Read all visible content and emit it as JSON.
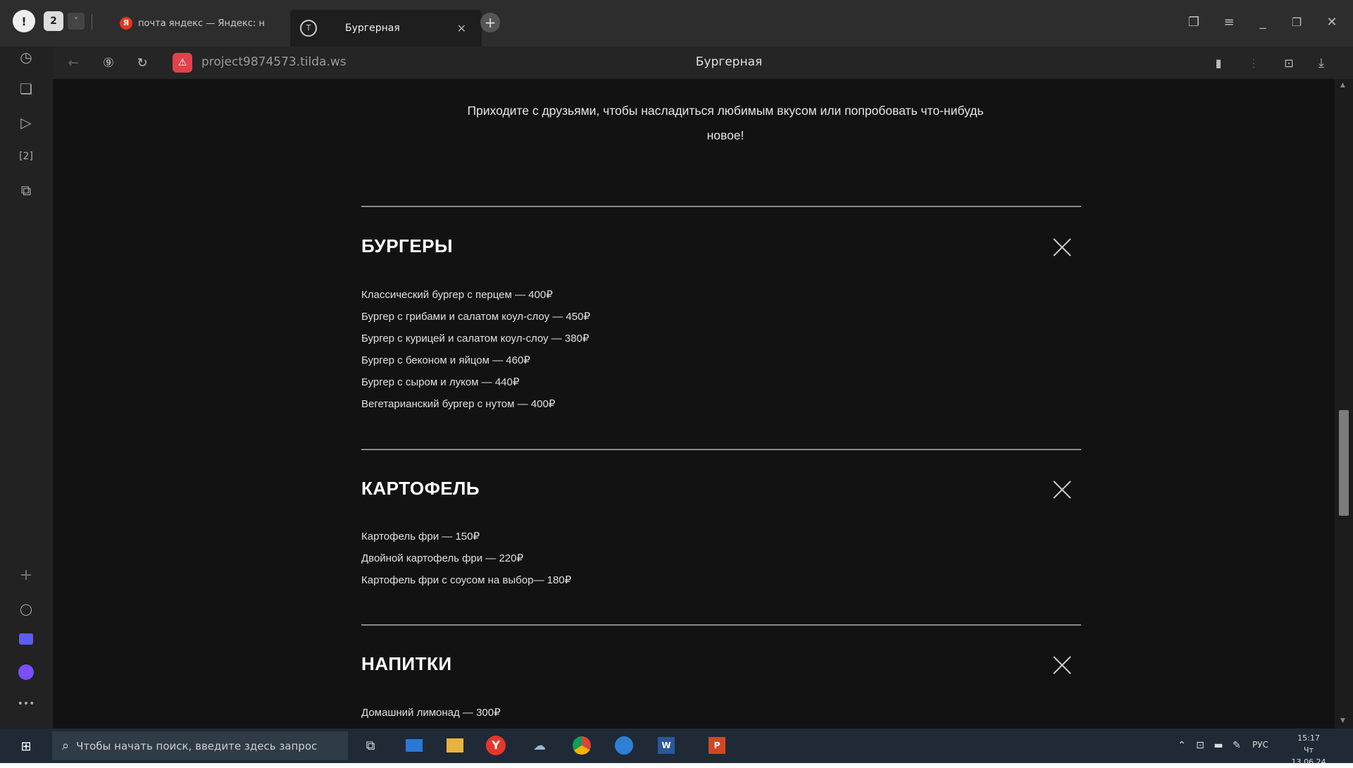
{
  "browser": {
    "tab_count": "2",
    "tabs": [
      {
        "label": "почта яндекс — Яндекс: н",
        "favicon": "yandex-y-icon"
      },
      {
        "label": "Бургерная",
        "favicon": "tilda-icon"
      }
    ],
    "new_tab_symbol": "+",
    "address": "project9874573.tilda.ws",
    "page_title": "Бургерная"
  },
  "page": {
    "intro_line1": "Приходите с друзьями, чтобы насладиться любимым вкусом или попробовать что-нибудь",
    "intro_line2": "новое!",
    "categories": [
      {
        "title": "БУРГЕРЫ",
        "items": [
          "Классический бургер с перцем — 400₽",
          "Бургер с грибами и салатом коул-слоу — 450₽",
          "Бургер с курицей и салатом коул-слоу — 380₽",
          "Бургер с беконом и яйцом — 460₽",
          "Бургер с сыром и луком — 440₽",
          "Вегетарианский бургер с нутом — 400₽"
        ]
      },
      {
        "title": "КАРТОФЕЛЬ",
        "items": [
          "Картофель фри — 150₽",
          "Двойной картофель фри — 220₽",
          "Картофель фри с соусом на выбор— 180₽"
        ]
      },
      {
        "title": "НАПИТКИ",
        "items": [
          "Домашний лимонад — 300₽"
        ]
      }
    ]
  },
  "taskbar": {
    "search_placeholder": "Чтобы начать поиск, введите здесь запрос",
    "language": "РУС",
    "time": "15:17",
    "date": "Чт 13.06.24"
  },
  "colors": {
    "page_bg": "#121212",
    "text": "#e6e6e6",
    "divider": "#8a8a8a",
    "warning_badge": "#e2424a"
  }
}
